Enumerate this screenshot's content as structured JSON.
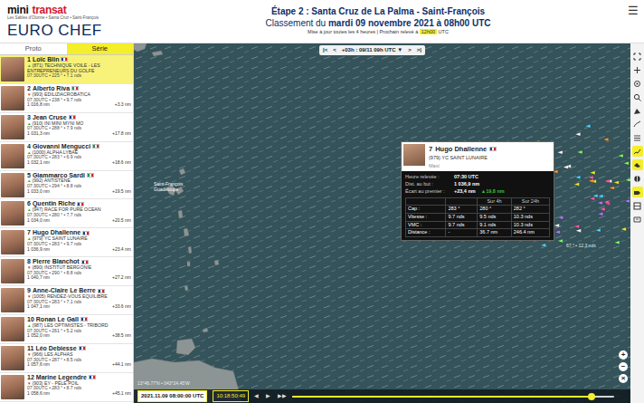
{
  "header": {
    "logo": {
      "brand": "mini",
      "brand2": "transat",
      "tagline": "Les Sables d'Olonne • Santa Cruz • Saint-François",
      "sponsor": "EURO CHEF"
    },
    "stage": "Étape 2 : Santa Cruz de La Palma - Saint-François",
    "ranking_prefix": "Classement du",
    "ranking_date": "mardi 09 novembre 2021 à 08h00 UTC",
    "update": "Mise à jour toutes les 4 heures | Prochain relevé à",
    "next_time": "12h00",
    "next_unit": "UTC",
    "menu": "☰"
  },
  "tabs": [
    {
      "label": "Proto",
      "selected": false
    },
    {
      "label": "Série",
      "selected": true
    }
  ],
  "ranking": [
    {
      "rank": "1",
      "name": "Loïc Blin",
      "flag": "fr",
      "arrow": "▲",
      "arrow_color": "#2faa2f",
      "boat": "(871) TECHNIQUE VOILE - LES ENTREPRENEURS DU GOLFE",
      "details": "07:30UTC • 225 ° • 7.1 nds",
      "gap": "",
      "distance": "",
      "selected": true
    },
    {
      "rank": "2",
      "name": "Alberto Riva",
      "flag": "it",
      "arrow": "▼",
      "arrow_color": "#d0302a",
      "boat": "(993) EDILIZIACROBATICA",
      "details": "07:30UTC • 238 ° • 9.7 nds",
      "distance": "1 016,8 nm",
      "gap": "+3.3 nm",
      "selected": false
    },
    {
      "rank": "3",
      "name": "Jean Cruse",
      "flag": "fr",
      "arrow": "▲",
      "arrow_color": "#2faa2f",
      "boat": "(910) INI MINI MYNI MO",
      "details": "07:30UTC • 288 ° • 7.9 nds",
      "distance": "1 031,3 nm",
      "gap": "+17.8 nm",
      "selected": false
    },
    {
      "rank": "4",
      "name": "Giovanni Mengucci",
      "flag": "it",
      "arrow": "▲",
      "arrow_color": "#2faa2f",
      "boat": "(1000) ALPHA LYBAE",
      "details": "07:30UTC • 283 ° • 6.9 nds",
      "distance": "1 032,1 nm",
      "gap": "+18.6 nm",
      "selected": false
    },
    {
      "rank": "5",
      "name": "Giammarco Sardi",
      "flag": "it",
      "arrow": "▲",
      "arrow_color": "#2faa2f",
      "boat": "(992) ANTISTENE",
      "details": "07:30UTC • 294 ° • 8.8 nds",
      "distance": "1 033,0 nm",
      "gap": "+19.5 nm",
      "selected": false
    },
    {
      "rank": "6",
      "name": "Quentin Riche",
      "flag": "fr",
      "arrow": "▲",
      "arrow_color": "#2faa2f",
      "boat": "(947) RACE FOR PURE OCEAN",
      "details": "07:30UTC • 280 ° • 7.7 nds",
      "distance": "1 034,0 nm",
      "gap": "+20.5 nm",
      "selected": false
    },
    {
      "rank": "7",
      "name": "Hugo Dhallenne",
      "flag": "fr",
      "arrow": "▲",
      "arrow_color": "#2faa2f",
      "boat": "(979) YC SAINT LUNAIRE",
      "details": "07:30UTC • 283 ° • 9.7 nds",
      "distance": "1 036,9 nm",
      "gap": "+23.4 nm",
      "selected": false
    },
    {
      "rank": "8",
      "name": "Pierre Blanchot",
      "flag": "fr",
      "arrow": "▼",
      "arrow_color": "#d0302a",
      "boat": "(890) INSTITUT BERGONIE",
      "details": "07:30UTC • 290 ° • 8.8 nds",
      "distance": "1 040,7 nm",
      "gap": "+27.2 nm",
      "selected": false
    },
    {
      "rank": "9",
      "name": "Anne-Claire Le Berre",
      "flag": "fr",
      "arrow": "▼",
      "arrow_color": "#d0302a",
      "boat": "(1005) RENDEZ-VOUS EQUILIBRE",
      "details": "07:30UTC • 283 ° • 7.1 nds",
      "distance": "1 047,1 nm",
      "gap": "+33.6 nm",
      "selected": false
    },
    {
      "rank": "10",
      "name": "Ronan Le Gall",
      "flag": "fr",
      "arrow": "▲",
      "arrow_color": "#2faa2f",
      "boat": "(987) LES OPTIMISTES - TRIBORD",
      "details": "07:30UTC • 261 ° • 5.2 nds",
      "distance": "1 052,0 nm",
      "gap": "+38.5 nm",
      "selected": false
    },
    {
      "rank": "11",
      "name": "Léo Debiesse",
      "flag": "fr",
      "arrow": "▼",
      "arrow_color": "#d0302a",
      "boat": "(966) LES ALPHAS",
      "details": "07:30UTC • 287 ° • 8.5 nds",
      "distance": "1 057,6 nm",
      "gap": "+44.1 nm",
      "selected": false
    },
    {
      "rank": "12",
      "name": "Marine Legendre",
      "flag": "fr",
      "arrow": "▼",
      "arrow_color": "#d0302a",
      "boat": "(903) EY - PÉLE POIL",
      "details": "07:30UTC • 283 ° • 8.7 nds",
      "distance": "1 058,6 nm",
      "gap": "+45.1 nm",
      "selected": false
    }
  ],
  "map": {
    "nav": [
      "|<",
      "<",
      "+03h : 09/11 09h UTC ▼",
      ">",
      ">|"
    ],
    "place": {
      "name": "Saint-François",
      "region": "Guadeloupe"
    },
    "wind_label": "67 ° • 12.3 nds",
    "coords": "13°46.77'N • 043°24.45'W",
    "zoom": [
      "+",
      "−",
      "×"
    ],
    "timestamp": "2021.11.09 08:00:00 UTC",
    "clock": "10:18:50:49",
    "controls": [
      "◀",
      "▶",
      "▶▶"
    ],
    "timeline_level": 0.93,
    "tools": [
      {
        "selected": false
      },
      {
        "selected": false
      },
      {
        "selected": false
      },
      {
        "selected": false
      },
      {
        "selected": false
      },
      {
        "selected": false
      },
      {
        "selected": false
      },
      {
        "selected": true
      },
      {
        "selected": true
      },
      {
        "selected": false
      },
      {
        "selected": true
      },
      {
        "selected": false
      },
      {
        "selected": false
      }
    ]
  },
  "tooltip": {
    "rank": "7",
    "name": "Hugo Dhallenne",
    "flag": "fr",
    "boat": "(979) YC SAINT LUNAIRE",
    "category": "Maxi",
    "facts": [
      {
        "label": "Heure relevée :",
        "value": "07:30 UTC",
        "delta": ""
      },
      {
        "label": "Dist. au but :",
        "value": "1 036,9 nm",
        "delta": ""
      },
      {
        "label": "Écart au premier :",
        "value": "+23,4 nm",
        "delta": "▲19,8 nm"
      }
    ],
    "delta_color": "#3bbf3b",
    "columns": [
      "Sur 4h",
      "Sur 24h"
    ],
    "rows": [
      [
        "Cap :",
        "283 °",
        "280 °",
        "282 °"
      ],
      [
        "Vitesse :",
        "9.7 nds",
        "9.5 nds",
        "10.3 nds"
      ],
      [
        "VMC :",
        "9.7 nds",
        "9.1 nds",
        "10.3 nds"
      ],
      [
        "Distance :",
        "-",
        "36.7 nm",
        "246.4 nm"
      ]
    ]
  }
}
